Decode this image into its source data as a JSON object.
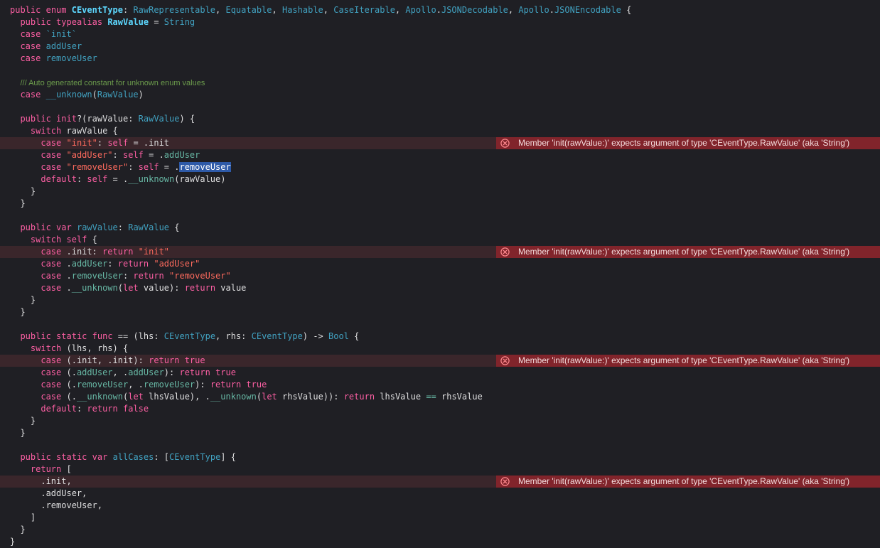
{
  "colors": {
    "background": "#1f1f24",
    "keyword": "#fc5fa3",
    "type": "#5dd8ff",
    "string": "#fc6a5d",
    "comment": "#6c9c4c",
    "error_line_bg": "#3a262b",
    "error_banner_bg": "#81242b"
  },
  "error_icon": "error-x-circle-icon",
  "error_message": "Member 'init(rawValue:)' expects argument of type 'CEventType.RawValue' (aka 'String')",
  "code_lines": [
    {
      "indent": "",
      "tokens": [
        [
          "kw",
          "public"
        ],
        [
          "pl",
          " "
        ],
        [
          "kw",
          "enum"
        ],
        [
          "pl",
          " "
        ],
        [
          "cls",
          "CEventType"
        ],
        [
          "pl",
          ": "
        ],
        [
          "tpl",
          "RawRepresentable"
        ],
        [
          "pl",
          ", "
        ],
        [
          "tpl",
          "Equatable"
        ],
        [
          "pl",
          ", "
        ],
        [
          "tpl",
          "Hashable"
        ],
        [
          "pl",
          ", "
        ],
        [
          "tpl",
          "CaseIterable"
        ],
        [
          "pl",
          ", "
        ],
        [
          "tpl",
          "Apollo"
        ],
        [
          "pl",
          "."
        ],
        [
          "tpl",
          "JSONDecodable"
        ],
        [
          "pl",
          ", "
        ],
        [
          "tpl",
          "Apollo"
        ],
        [
          "pl",
          "."
        ],
        [
          "tpl",
          "JSONEncodable"
        ],
        [
          "pl",
          " {"
        ]
      ]
    },
    {
      "indent": "  ",
      "tokens": [
        [
          "kw",
          "public"
        ],
        [
          "pl",
          " "
        ],
        [
          "kw",
          "typealias"
        ],
        [
          "pl",
          " "
        ],
        [
          "cls",
          "RawValue"
        ],
        [
          "pl",
          " = "
        ],
        [
          "tpl",
          "String"
        ]
      ]
    },
    {
      "indent": "  ",
      "tokens": [
        [
          "kw",
          "case"
        ],
        [
          "pl",
          " "
        ],
        [
          "dcl",
          "`init`"
        ]
      ]
    },
    {
      "indent": "  ",
      "tokens": [
        [
          "kw",
          "case"
        ],
        [
          "pl",
          " "
        ],
        [
          "dcl",
          "addUser"
        ]
      ]
    },
    {
      "indent": "  ",
      "tokens": [
        [
          "kw",
          "case"
        ],
        [
          "pl",
          " "
        ],
        [
          "dcl",
          "removeUser"
        ]
      ]
    },
    {
      "indent": "",
      "tokens": []
    },
    {
      "indent": "  ",
      "comment": true,
      "tokens": [
        [
          "slash",
          "/// "
        ],
        [
          "cmt",
          "Auto generated constant for unknown enum values"
        ]
      ]
    },
    {
      "indent": "  ",
      "tokens": [
        [
          "kw",
          "case"
        ],
        [
          "pl",
          " "
        ],
        [
          "dcl",
          "__unknown"
        ],
        [
          "pl",
          "("
        ],
        [
          "tpl",
          "RawValue"
        ],
        [
          "pl",
          ")"
        ]
      ]
    },
    {
      "indent": "",
      "tokens": []
    },
    {
      "indent": "  ",
      "tokens": [
        [
          "kw",
          "public"
        ],
        [
          "pl",
          " "
        ],
        [
          "kw",
          "init"
        ],
        [
          "pl",
          "?(rawValue: "
        ],
        [
          "tpl",
          "RawValue"
        ],
        [
          "pl",
          ") {"
        ]
      ]
    },
    {
      "indent": "    ",
      "tokens": [
        [
          "kw",
          "switch"
        ],
        [
          "pl",
          " rawValue {"
        ]
      ]
    },
    {
      "indent": "      ",
      "error": true,
      "tokens": [
        [
          "kw",
          "case"
        ],
        [
          "pl",
          " "
        ],
        [
          "str",
          "\"init\""
        ],
        [
          "pl",
          ": "
        ],
        [
          "kw",
          "self"
        ],
        [
          "pl",
          " = .init"
        ]
      ]
    },
    {
      "indent": "      ",
      "tokens": [
        [
          "kw",
          "case"
        ],
        [
          "pl",
          " "
        ],
        [
          "str",
          "\"addUser\""
        ],
        [
          "pl",
          ": "
        ],
        [
          "kw",
          "self"
        ],
        [
          "pl",
          " = ."
        ],
        [
          "mem",
          "addUser"
        ]
      ]
    },
    {
      "indent": "      ",
      "tokens": [
        [
          "kw",
          "case"
        ],
        [
          "pl",
          " "
        ],
        [
          "str",
          "\"removeUser\""
        ],
        [
          "pl",
          ": "
        ],
        [
          "kw",
          "self"
        ],
        [
          "pl",
          " = ."
        ],
        [
          "sel",
          "removeUser"
        ]
      ]
    },
    {
      "indent": "      ",
      "tokens": [
        [
          "kw",
          "default"
        ],
        [
          "pl",
          ": "
        ],
        [
          "kw",
          "self"
        ],
        [
          "pl",
          " = ."
        ],
        [
          "mem",
          "__unknown"
        ],
        [
          "pl",
          "(rawValue)"
        ]
      ]
    },
    {
      "indent": "    ",
      "tokens": [
        [
          "pl",
          "}"
        ]
      ]
    },
    {
      "indent": "  ",
      "tokens": [
        [
          "pl",
          "}"
        ]
      ]
    },
    {
      "indent": "",
      "tokens": []
    },
    {
      "indent": "  ",
      "tokens": [
        [
          "kw",
          "public"
        ],
        [
          "pl",
          " "
        ],
        [
          "kw",
          "var"
        ],
        [
          "pl",
          " "
        ],
        [
          "dcl",
          "rawValue"
        ],
        [
          "pl",
          ": "
        ],
        [
          "tpl",
          "RawValue"
        ],
        [
          "pl",
          " {"
        ]
      ]
    },
    {
      "indent": "    ",
      "tokens": [
        [
          "kw",
          "switch"
        ],
        [
          "pl",
          " "
        ],
        [
          "kw",
          "self"
        ],
        [
          "pl",
          " {"
        ]
      ]
    },
    {
      "indent": "      ",
      "error": true,
      "tokens": [
        [
          "kw",
          "case"
        ],
        [
          "pl",
          " ."
        ],
        [
          "pl",
          "init"
        ],
        [
          "pl",
          ": "
        ],
        [
          "kw",
          "return"
        ],
        [
          "pl",
          " "
        ],
        [
          "str",
          "\"init\""
        ]
      ]
    },
    {
      "indent": "      ",
      "tokens": [
        [
          "kw",
          "case"
        ],
        [
          "pl",
          " ."
        ],
        [
          "mem",
          "addUser"
        ],
        [
          "pl",
          ": "
        ],
        [
          "kw",
          "return"
        ],
        [
          "pl",
          " "
        ],
        [
          "str",
          "\"addUser\""
        ]
      ]
    },
    {
      "indent": "      ",
      "tokens": [
        [
          "kw",
          "case"
        ],
        [
          "pl",
          " ."
        ],
        [
          "mem",
          "removeUser"
        ],
        [
          "pl",
          ": "
        ],
        [
          "kw",
          "return"
        ],
        [
          "pl",
          " "
        ],
        [
          "str",
          "\"removeUser\""
        ]
      ]
    },
    {
      "indent": "      ",
      "tokens": [
        [
          "kw",
          "case"
        ],
        [
          "pl",
          " ."
        ],
        [
          "mem",
          "__unknown"
        ],
        [
          "pl",
          "("
        ],
        [
          "kw",
          "let"
        ],
        [
          "pl",
          " value): "
        ],
        [
          "kw",
          "return"
        ],
        [
          "pl",
          " value"
        ]
      ]
    },
    {
      "indent": "    ",
      "tokens": [
        [
          "pl",
          "}"
        ]
      ]
    },
    {
      "indent": "  ",
      "tokens": [
        [
          "pl",
          "}"
        ]
      ]
    },
    {
      "indent": "",
      "tokens": []
    },
    {
      "indent": "  ",
      "tokens": [
        [
          "kw",
          "public"
        ],
        [
          "pl",
          " "
        ],
        [
          "kw",
          "static"
        ],
        [
          "pl",
          " "
        ],
        [
          "kw",
          "func"
        ],
        [
          "pl",
          " == (lhs: "
        ],
        [
          "tpl",
          "CEventType"
        ],
        [
          "pl",
          ", rhs: "
        ],
        [
          "tpl",
          "CEventType"
        ],
        [
          "pl",
          ") -> "
        ],
        [
          "tpl",
          "Bool"
        ],
        [
          "pl",
          " {"
        ]
      ]
    },
    {
      "indent": "    ",
      "tokens": [
        [
          "kw",
          "switch"
        ],
        [
          "pl",
          " (lhs, rhs) {"
        ]
      ]
    },
    {
      "indent": "      ",
      "error": true,
      "tokens": [
        [
          "kw",
          "case"
        ],
        [
          "pl",
          " (.init, .init): "
        ],
        [
          "kw",
          "return"
        ],
        [
          "pl",
          " "
        ],
        [
          "kw",
          "true"
        ]
      ]
    },
    {
      "indent": "      ",
      "tokens": [
        [
          "kw",
          "case"
        ],
        [
          "pl",
          " (."
        ],
        [
          "mem",
          "addUser"
        ],
        [
          "pl",
          ", ."
        ],
        [
          "mem",
          "addUser"
        ],
        [
          "pl",
          "): "
        ],
        [
          "kw",
          "return"
        ],
        [
          "pl",
          " "
        ],
        [
          "kw",
          "true"
        ]
      ]
    },
    {
      "indent": "      ",
      "tokens": [
        [
          "kw",
          "case"
        ],
        [
          "pl",
          " (."
        ],
        [
          "mem",
          "removeUser"
        ],
        [
          "pl",
          ", ."
        ],
        [
          "mem",
          "removeUser"
        ],
        [
          "pl",
          "): "
        ],
        [
          "kw",
          "return"
        ],
        [
          "pl",
          " "
        ],
        [
          "kw",
          "true"
        ]
      ]
    },
    {
      "indent": "      ",
      "tokens": [
        [
          "kw",
          "case"
        ],
        [
          "pl",
          " (."
        ],
        [
          "mem",
          "__unknown"
        ],
        [
          "pl",
          "("
        ],
        [
          "kw",
          "let"
        ],
        [
          "pl",
          " lhsValue), ."
        ],
        [
          "mem",
          "__unknown"
        ],
        [
          "pl",
          "("
        ],
        [
          "kw",
          "let"
        ],
        [
          "pl",
          " rhsValue)): "
        ],
        [
          "kw",
          "return"
        ],
        [
          "pl",
          " lhsValue "
        ],
        [
          "mem",
          "=="
        ],
        [
          "pl",
          " rhsValue"
        ]
      ]
    },
    {
      "indent": "      ",
      "tokens": [
        [
          "kw",
          "default"
        ],
        [
          "pl",
          ": "
        ],
        [
          "kw",
          "return"
        ],
        [
          "pl",
          " "
        ],
        [
          "kw",
          "false"
        ]
      ]
    },
    {
      "indent": "    ",
      "tokens": [
        [
          "pl",
          "}"
        ]
      ]
    },
    {
      "indent": "  ",
      "tokens": [
        [
          "pl",
          "}"
        ]
      ]
    },
    {
      "indent": "",
      "tokens": []
    },
    {
      "indent": "  ",
      "tokens": [
        [
          "kw",
          "public"
        ],
        [
          "pl",
          " "
        ],
        [
          "kw",
          "static"
        ],
        [
          "pl",
          " "
        ],
        [
          "kw",
          "var"
        ],
        [
          "pl",
          " "
        ],
        [
          "dcl",
          "allCases"
        ],
        [
          "pl",
          ": ["
        ],
        [
          "tpl",
          "CEventType"
        ],
        [
          "pl",
          "] {"
        ]
      ]
    },
    {
      "indent": "    ",
      "tokens": [
        [
          "kw",
          "return"
        ],
        [
          "pl",
          " ["
        ]
      ]
    },
    {
      "indent": "      ",
      "error": true,
      "tokens": [
        [
          "pl",
          ".init,"
        ]
      ]
    },
    {
      "indent": "      ",
      "tokens": [
        [
          "pl",
          ".addUser,"
        ]
      ]
    },
    {
      "indent": "      ",
      "tokens": [
        [
          "pl",
          ".removeUser,"
        ]
      ]
    },
    {
      "indent": "    ",
      "tokens": [
        [
          "pl",
          "]"
        ]
      ]
    },
    {
      "indent": "  ",
      "tokens": [
        [
          "pl",
          "}"
        ]
      ]
    },
    {
      "indent": "",
      "tokens": [
        [
          "pl",
          "}"
        ]
      ]
    }
  ]
}
